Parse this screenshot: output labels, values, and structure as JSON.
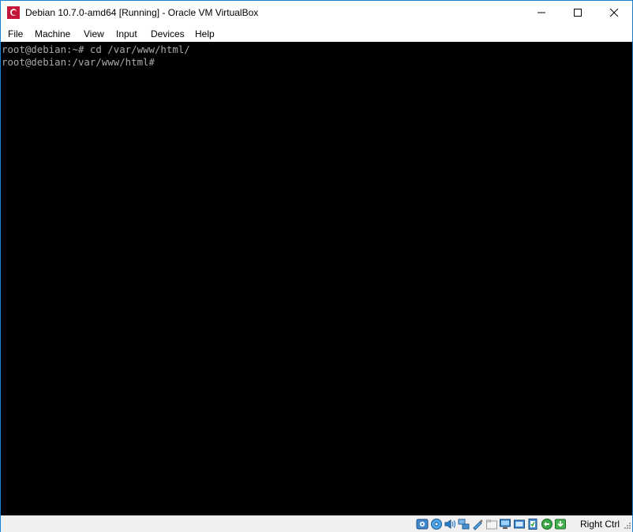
{
  "window": {
    "title": "Debian 10.7.0-amd64 [Running] - Oracle VM VirtualBox",
    "accent": "#1883d7"
  },
  "menu": {
    "items": [
      {
        "label": "File"
      },
      {
        "label": "Machine"
      },
      {
        "label": "View"
      },
      {
        "label": "Input"
      },
      {
        "label": "Devices"
      },
      {
        "label": "Help"
      }
    ]
  },
  "console": {
    "lines": [
      "root@debian:~# cd /var/www/html/",
      "root@debian:/var/www/html#"
    ],
    "text_color": "#aaaaaa",
    "background": "#000000"
  },
  "statusbar": {
    "icons": [
      "hard-disk-icon",
      "optical-drive-icon",
      "audio-icon",
      "network-icon",
      "usb-icon",
      "shared-folders-icon",
      "display-icon",
      "recording-icon",
      "cpu-icon",
      "mouse-integration-icon",
      "keyboard-capture-icon"
    ],
    "host_key": "Right Ctrl"
  }
}
